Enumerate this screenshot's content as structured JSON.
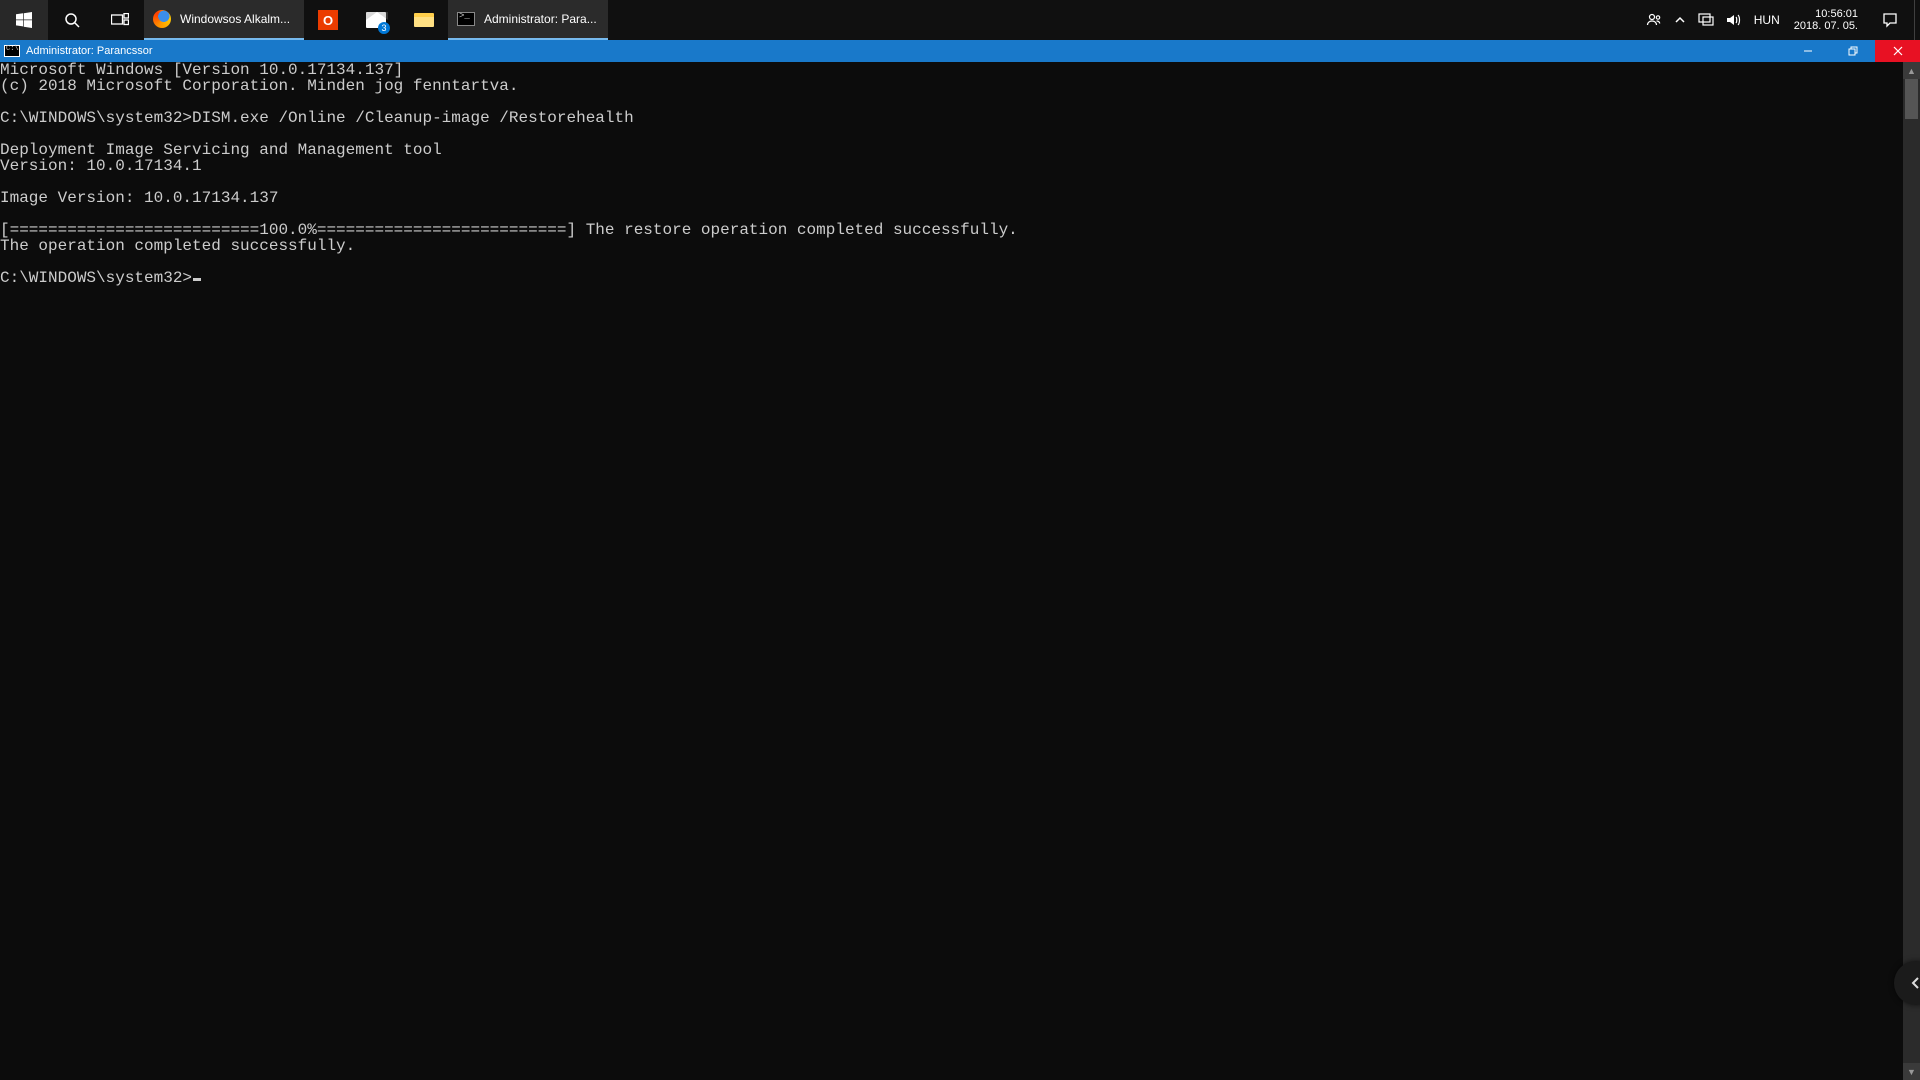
{
  "taskbar": {
    "apps": {
      "firefox_label": "Windowsos Alkalm...",
      "cmd_label": "Administrator: Para..."
    },
    "mail_badge": "3",
    "tray": {
      "lang": "HUN",
      "time": "10:56:01",
      "date": "2018. 07. 05."
    }
  },
  "window": {
    "title": "Administrator: Parancssor"
  },
  "console": {
    "lines": [
      "Microsoft Windows [Version 10.0.17134.137]",
      "(c) 2018 Microsoft Corporation. Minden jog fenntartva.",
      "",
      "C:\\WINDOWS\\system32>DISM.exe /Online /Cleanup-image /Restorehealth",
      "",
      "Deployment Image Servicing and Management tool",
      "Version: 10.0.17134.1",
      "",
      "Image Version: 10.0.17134.137",
      "",
      "[==========================100.0%==========================] The restore operation completed successfully.",
      "The operation completed successfully.",
      ""
    ],
    "prompt": "C:\\WINDOWS\\system32>"
  }
}
